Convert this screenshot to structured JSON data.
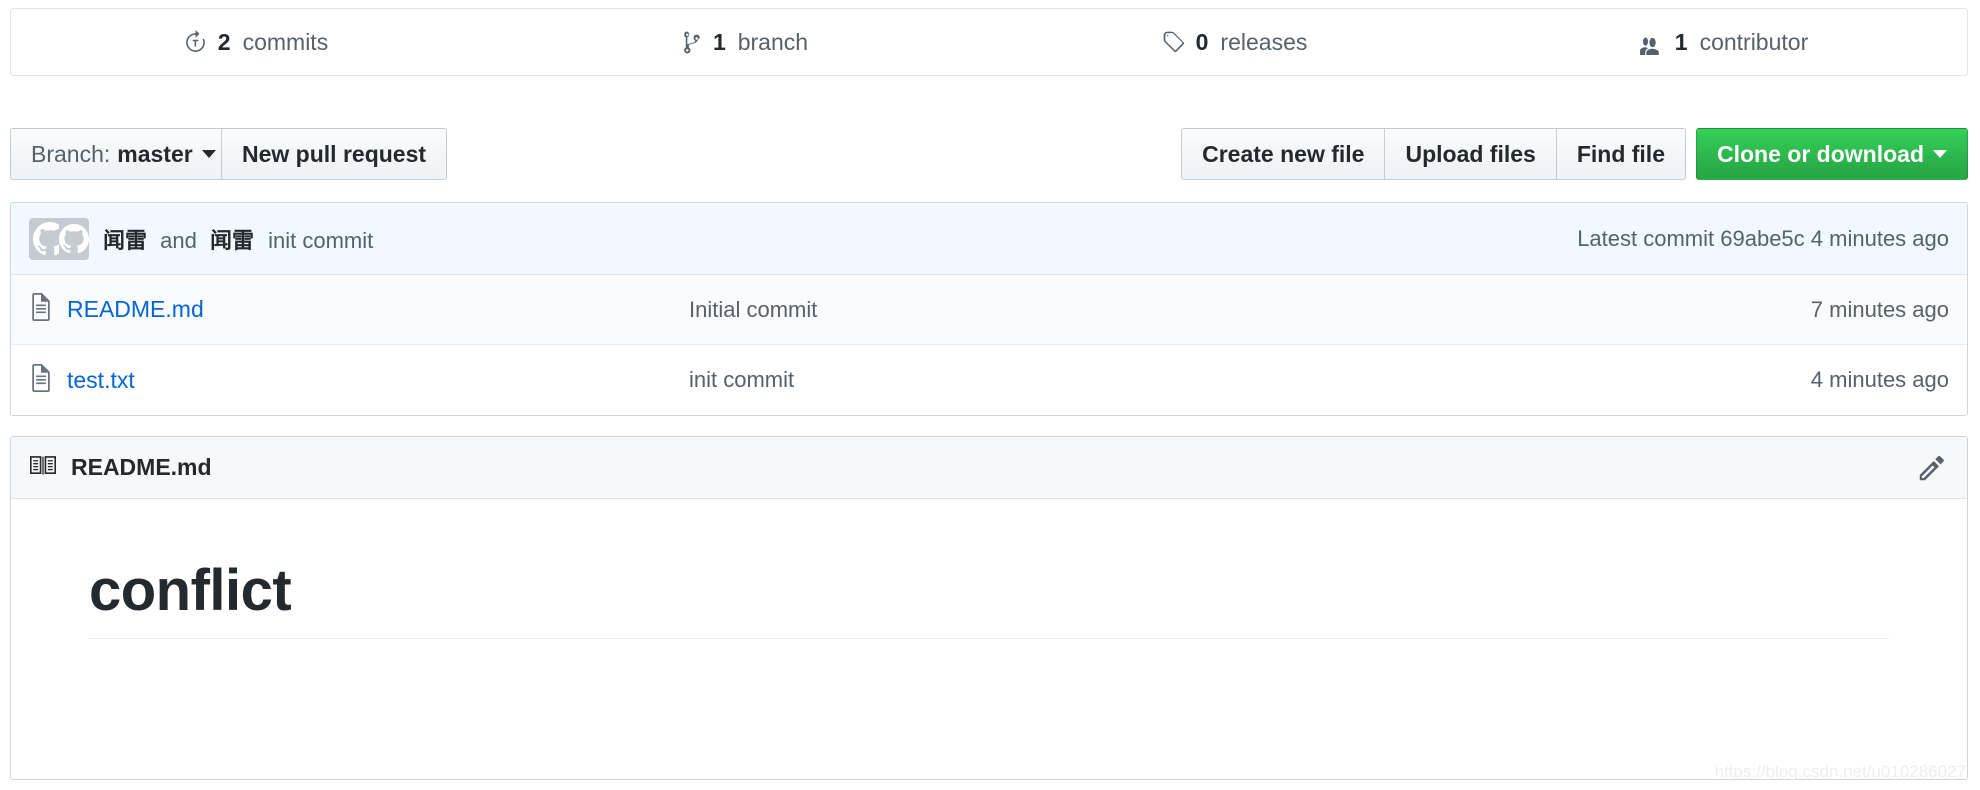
{
  "stats": [
    {
      "icon": "history-icon",
      "count": "2",
      "label": "commits"
    },
    {
      "icon": "git-branch-icon",
      "count": "1",
      "label": "branch"
    },
    {
      "icon": "tag-icon",
      "count": "0",
      "label": "releases"
    },
    {
      "icon": "people-icon",
      "count": "1",
      "label": "contributor"
    }
  ],
  "toolbar": {
    "branch_prefix": "Branch:",
    "branch_value": "master",
    "new_pull_request": "New pull request",
    "create_new_file": "Create new file",
    "upload_files": "Upload files",
    "find_file": "Find file",
    "clone_or_download": "Clone or download"
  },
  "commit_bar": {
    "author": "闻雷",
    "and": "and",
    "coauthor": "闻雷",
    "message": "init commit",
    "latest_prefix": "Latest commit",
    "sha": "69abe5c",
    "age": "4 minutes ago",
    "avatar_icon": "github-octocat-avatar"
  },
  "files": [
    {
      "icon": "file-icon",
      "name": "README.md",
      "message": "Initial commit",
      "age": "7 minutes ago"
    },
    {
      "icon": "file-icon",
      "name": "test.txt",
      "message": "init commit",
      "age": "4 minutes ago"
    }
  ],
  "readme": {
    "icon": "book-icon",
    "title": "README.md",
    "edit_icon": "pencil-icon",
    "heading": "conflict"
  },
  "watermark": "https://blog.csdn.net/u010286027",
  "colors": {
    "link": "#0366d6",
    "clone_green": "#28a745",
    "commit_bar_bg": "#f1f8ff",
    "border": "#d1d5da",
    "muted_text": "#586069"
  }
}
